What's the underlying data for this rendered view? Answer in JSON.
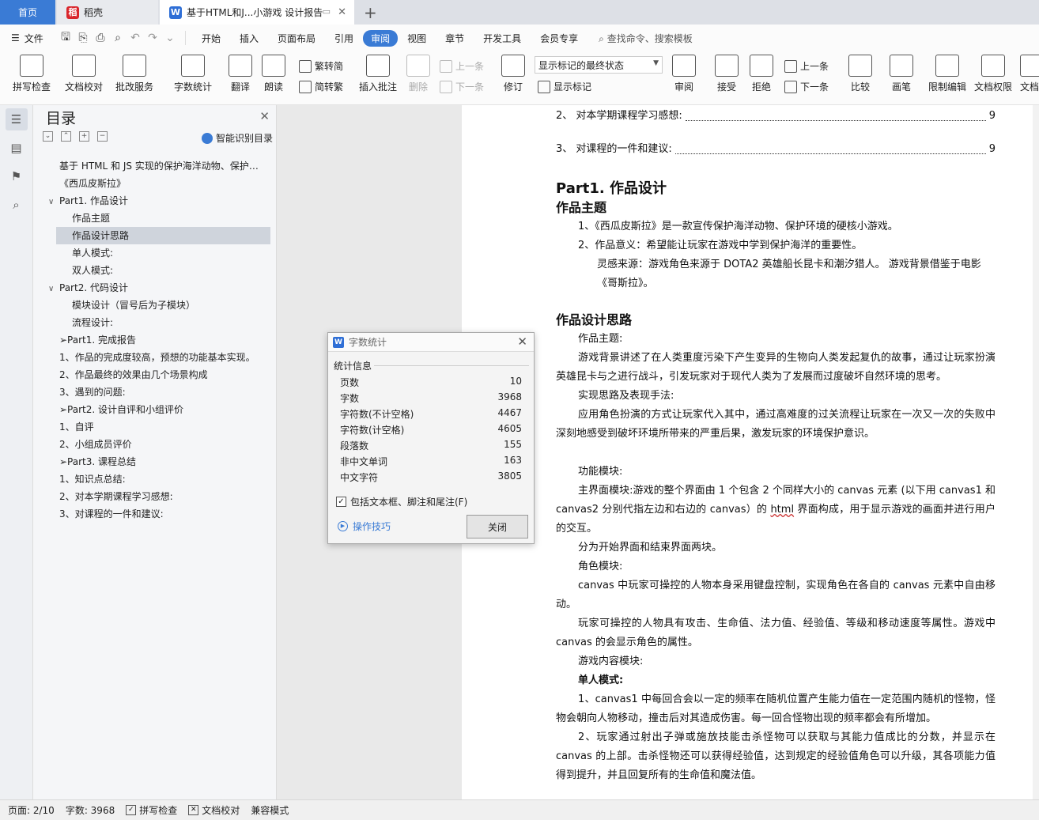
{
  "tabs": {
    "home": "首页",
    "daoke": "稻壳",
    "doc": "基于HTML和J...小游戏 设计报告"
  },
  "menu": {
    "file": "文件",
    "items": [
      "开始",
      "插入",
      "页面布局",
      "引用",
      "审阅",
      "视图",
      "章节",
      "开发工具",
      "会员专享"
    ],
    "active_index": 4,
    "search": "查找命令、搜索模板"
  },
  "ribbon": {
    "spell": "拼写检查",
    "proof": "文档校对",
    "review_service": "批改服务",
    "word_count": "字数统计",
    "translate": "翻译",
    "read": "朗读",
    "trad": "繁转简",
    "simp": "简转繁",
    "insert_comment": "插入批注",
    "delete": "删除",
    "prev_comment": "上一条",
    "next_comment": "下一条",
    "track": "修订",
    "show_state": "显示标记的最终状态",
    "show_marks": "显示标记",
    "review": "审阅",
    "accept": "接受",
    "reject": "拒绝",
    "prev": "上一条",
    "next": "下一条",
    "compare": "比较",
    "pen": "画笔",
    "restrict": "限制编辑",
    "permission": "文档权限",
    "more": "文档"
  },
  "toc": {
    "title": "目录",
    "smart": "智能识别目录",
    "items": [
      {
        "text": "基于 HTML 和 JS 实现的保护海洋动物、保护 ...",
        "level": "l1"
      },
      {
        "text": "《西瓜皮斯拉》",
        "level": "l1"
      },
      {
        "text": "Part1. 作品设计",
        "level": "l1c",
        "caret": "∨"
      },
      {
        "text": "作品主题",
        "level": "l2"
      },
      {
        "text": "作品设计思路",
        "level": "l2",
        "selected": true
      },
      {
        "text": "单人模式:",
        "level": "l2"
      },
      {
        "text": "双人模式:",
        "level": "l2"
      },
      {
        "text": "Part2. 代码设计",
        "level": "l1c",
        "caret": "∨"
      },
      {
        "text": "模块设计（冒号后为子模块）",
        "level": "l2"
      },
      {
        "text": "流程设计:",
        "level": "l2"
      },
      {
        "text": "➢Part1. 完成报告",
        "level": "l1"
      },
      {
        "text": "1、作品的完成度较高，预想的功能基本实现。",
        "level": "l1"
      },
      {
        "text": "2、作品最终的效果由几个场景构成",
        "level": "l1"
      },
      {
        "text": "3、遇到的问题:",
        "level": "l1"
      },
      {
        "text": "➢Part2. 设计自评和小组评价",
        "level": "l1"
      },
      {
        "text": "1、自评",
        "level": "l1"
      },
      {
        "text": "2、小组成员评价",
        "level": "l1"
      },
      {
        "text": "➢Part3. 课程总结",
        "level": "l1"
      },
      {
        "text": "1、知识点总结:",
        "level": "l1"
      },
      {
        "text": "2、对本学期课程学习感想:",
        "level": "l1"
      },
      {
        "text": "3、对课程的一件和建议:",
        "level": "l1"
      }
    ]
  },
  "doc": {
    "toc_lines": [
      {
        "text": "2、 对本学期课程学习感想:",
        "page": "9"
      },
      {
        "text": "3、 对课程的一件和建议:",
        "page": "9"
      }
    ],
    "h1": "Part1. 作品设计",
    "h2_theme": "作品主题",
    "theme_1": "1、《西瓜皮斯拉》是一款宣传保护海洋动物、保护环境的硬核小游戏。",
    "theme_2": "2、作品意义：希望能让玩家在游戏中学到保护海洋的重要性。",
    "theme_3": "灵感来源：游戏角色来源于 DOTA2 英雄船长昆卡和潮汐猎人。 游戏背景借鉴于电影《哥斯拉》。",
    "h2_idea": "作品设计思路",
    "p1": "作品主题:",
    "p2": "游戏背景讲述了在人类重度污染下产生变异的生物向人类发起复仇的故事，通过让玩家扮演英雄昆卡与之进行战斗，引发玩家对于现代人类为了发展而过度破坏自然环境的思考。",
    "p3": "实现思路及表现手法:",
    "p4": "应用角色扮演的方式让玩家代入其中，通过高难度的过关流程让玩家在一次又一次的失败中深刻地感受到破坏环境所带来的严重后果，激发玩家的环境保护意识。",
    "p5": "功能模块:",
    "p6a": "主界面模块:游戏的整个界面由 1 个包含 2 个同样大小的 canvas 元素 (以下用 canvas1 和 canvas2 分别代指左边和右边的 canvas）的 ",
    "p6b": "html",
    "p6c": " 界面构成，用于显示游戏的画面并进行用户的交互。",
    "p7": "分为开始界面和结束界面两块。",
    "p8": "角色模块:",
    "p9": "canvas 中玩家可操控的人物本身采用键盘控制，实现角色在各自的 canvas 元素中自由移动。",
    "p10": "玩家可操控的人物具有攻击、生命值、法力值、经验值、等级和移动速度等属性。游戏中 canvas 的会显示角色的属性。",
    "p11": "游戏内容模块:",
    "p12": "单人模式:",
    "p13": "1、canvas1 中每回合会以一定的频率在随机位置产生能力值在一定范围内随机的怪物，怪物会朝向人物移动，撞击后对其造成伤害。每一回合怪物出现的频率都会有所增加。",
    "p14": "2、玩家通过射出子弹或施放技能击杀怪物可以获取与其能力值成比的分数，并显示在 canvas 的上部。击杀怪物还可以获得经验值，达到规定的经验值角色可以升级，其各项能力值得到提升，并且回复所有的生命值和魔法值。"
  },
  "dialog": {
    "title": "字数统计",
    "section": "统计信息",
    "stats": [
      {
        "label": "页数",
        "value": "10"
      },
      {
        "label": "字数",
        "value": "3968"
      },
      {
        "label": "字符数(不计空格)",
        "value": "4467"
      },
      {
        "label": "字符数(计空格)",
        "value": "4605"
      },
      {
        "label": "段落数",
        "value": "155"
      },
      {
        "label": "非中文单词",
        "value": "163"
      },
      {
        "label": "中文字符",
        "value": "3805"
      }
    ],
    "checkbox": "包括文本框、脚注和尾注(F)",
    "tips": "操作技巧",
    "close": "关闭"
  },
  "status": {
    "page": "页面: 2/10",
    "words": "字数: 3968",
    "spell": "拼写检查",
    "proof": "文档校对",
    "compat": "兼容模式"
  },
  "colors": {
    "accent": "#3a7bd5",
    "selection": "#cfd4dc"
  }
}
